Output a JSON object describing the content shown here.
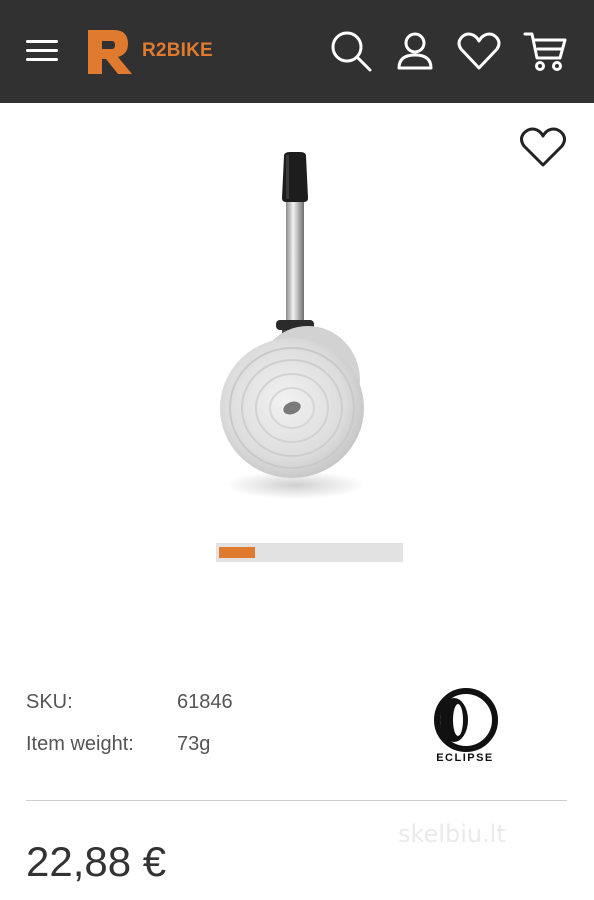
{
  "header": {
    "logo_text": "R2BIKE",
    "icons": [
      "menu-icon",
      "search-icon",
      "user-icon",
      "heart-icon",
      "cart-icon"
    ],
    "background_color": "#313131",
    "brand_color": "#e07a2e"
  },
  "gallery": {
    "image_alt": "Presta valve inner tube",
    "wishlist_icon": "heart-outline-icon",
    "carousel": {
      "current_fraction": 0.2,
      "indicator_color": "#e07a2e"
    }
  },
  "specs": {
    "sku_label": "SKU:",
    "sku_value": "61846",
    "weight_label": "Item weight:",
    "weight_value": "73g"
  },
  "brand": {
    "name": "ECLIPSE"
  },
  "price": {
    "value": "22,88 €"
  },
  "watermark": {
    "text": "skelbiu.lt"
  }
}
